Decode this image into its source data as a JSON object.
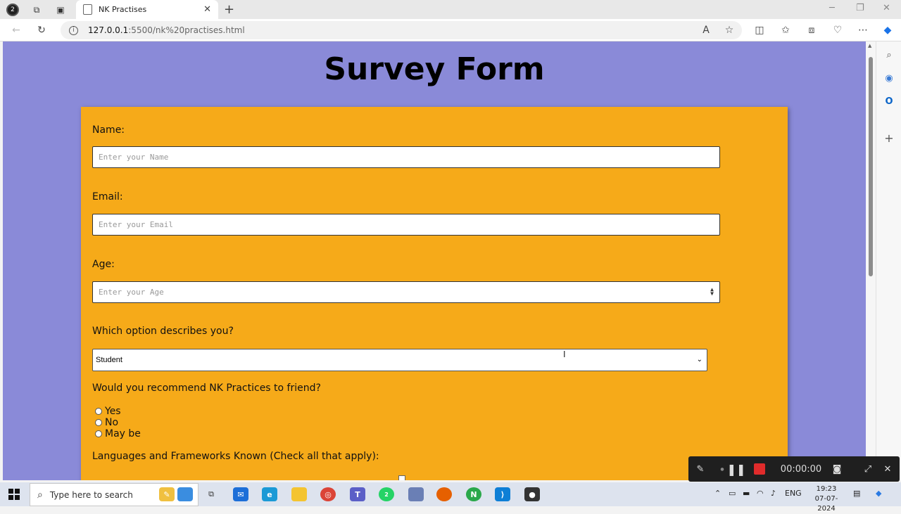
{
  "browser": {
    "tab_title": "NK Practises",
    "url_host": "127.0.0.1",
    "url_path": ":5500/nk%20practises.html",
    "profile_badge": "2"
  },
  "page": {
    "title": "Survey Form",
    "name_label": "Name:",
    "name_placeholder": "Enter your Name",
    "email_label": "Email:",
    "email_placeholder": "Enter your Email",
    "age_label": "Age:",
    "age_placeholder": "Enter your Age",
    "role_label": "Which option describes you?",
    "role_selected": "Student",
    "recommend_label": "Would you recommend NK Practices to friend?",
    "recommend_options": [
      "Yes",
      "No",
      "May be"
    ],
    "languages_label": "Languages and Frameworks Known (Check all that apply):"
  },
  "recorder": {
    "timer": "00:00:00"
  },
  "taskbar": {
    "search_placeholder": "Type here to search",
    "language": "ENG",
    "time": "19:23",
    "date": "07-07-2024",
    "whatsapp_badge": "2"
  },
  "colors": {
    "page_background": "#8a8ad8",
    "form_background": "#f6aa19"
  }
}
